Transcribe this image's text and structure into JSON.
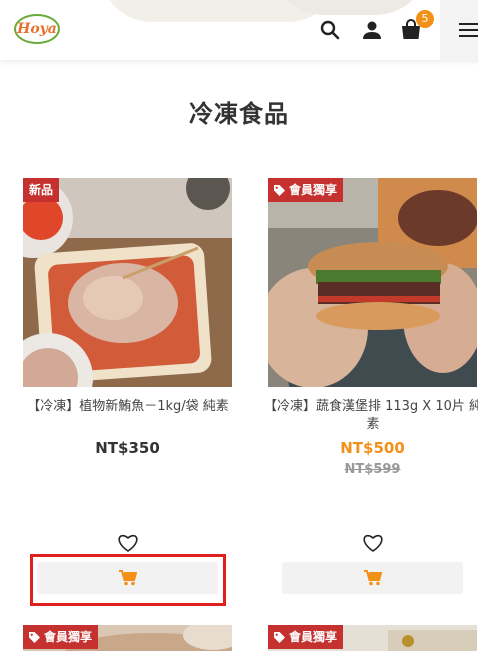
{
  "header": {
    "logo_text": "Hoya",
    "cart_count": "5",
    "icons": [
      "search-icon",
      "user-icon",
      "shopping-bag-icon",
      "hamburger-menu-icon"
    ]
  },
  "section": {
    "title": "冷凍食品"
  },
  "products": [
    {
      "badge": "新品",
      "name": "【冷凍】植物新鮪魚－1kg/袋 純素",
      "price": "NT$350",
      "original_price": ""
    },
    {
      "badge": "會員獨享",
      "name": "【冷凍】蔬食漢堡排 113g X 10片 純素",
      "price": "NT$500",
      "original_price": "NT$599"
    },
    {
      "badge": "會員獨享"
    },
    {
      "badge": "會員獨享"
    }
  ],
  "colors": {
    "accent": "#f39018",
    "badge_red": "#c4312f",
    "brand_green": "#6aaa3a",
    "highlight": "#e0201f"
  }
}
